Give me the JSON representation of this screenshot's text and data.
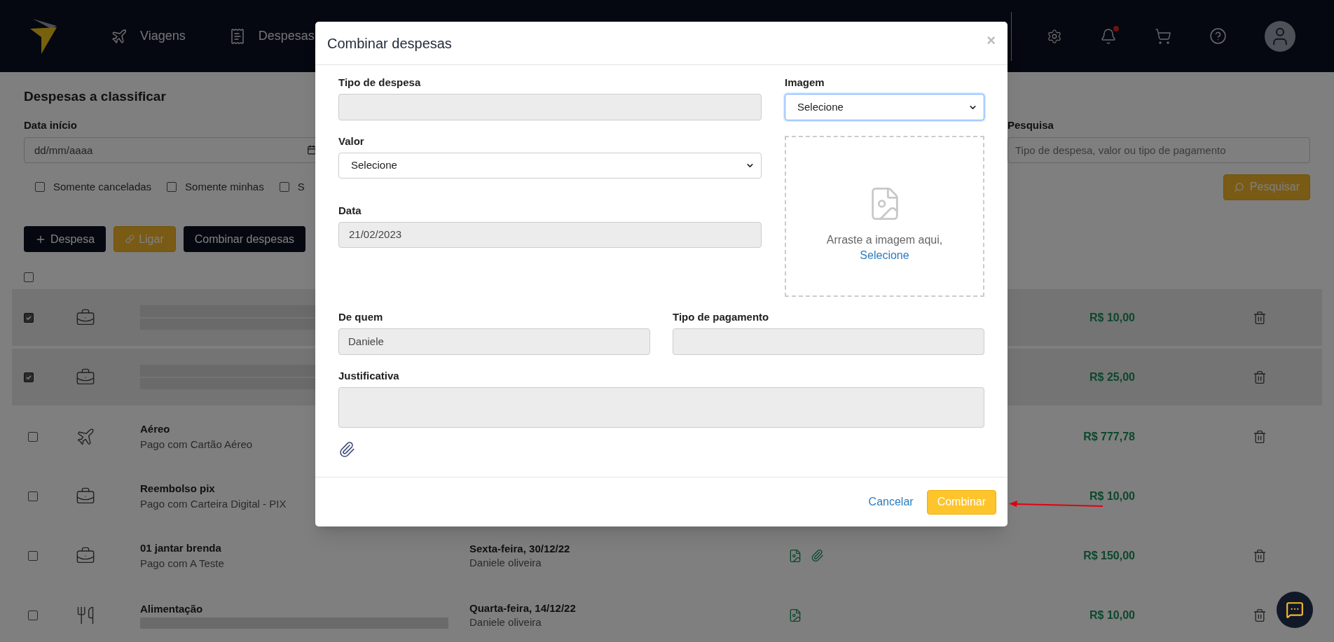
{
  "app_bar": {
    "nav": [
      {
        "label": "Viagens",
        "kind": "trips"
      },
      {
        "label": "Despesas",
        "kind": "expenses"
      }
    ],
    "has_notifications": true
  },
  "page": {
    "title": "Despesas a classificar",
    "start_date": {
      "label": "Data início",
      "placeholder": "dd/mm/aaaa"
    },
    "search": {
      "label": "Pesquisa",
      "placeholder": "Tipo de despesa, valor ou tipo de pagamento"
    },
    "checkboxes": [
      {
        "label": "Somente canceladas",
        "checked": false
      },
      {
        "label": "Somente minhas",
        "checked": false
      },
      {
        "label": "S",
        "checked": false
      }
    ],
    "search_button": "Pesquisar",
    "actions": [
      {
        "label": "Despesa",
        "kind": "add"
      },
      {
        "label": "Ligar",
        "kind": "link"
      },
      {
        "label": "Combinar despesas",
        "kind": "plain"
      }
    ],
    "select_all": {
      "checked": false
    },
    "rows": [
      {
        "selected": true,
        "checked": true,
        "kind": "travel",
        "amount": "R$ 10,00",
        "deletable": true
      },
      {
        "selected": true,
        "checked": true,
        "kind": "travel",
        "amount": "R$ 25,00",
        "deletable": true
      },
      {
        "selected": false,
        "checked": false,
        "kind": "flight",
        "title": "Aéreo",
        "subtitle": "Pago com Cartão Aéreo",
        "amount": "R$ 777,78",
        "deletable": true
      },
      {
        "selected": false,
        "checked": false,
        "kind": "travel",
        "title": "Reembolso pix",
        "subtitle": "Pago com Carteira Digital - PIX",
        "amount": "R$ 10,00",
        "deletable": false
      },
      {
        "selected": false,
        "checked": false,
        "kind": "travel",
        "title": "01 jantar brenda",
        "subtitle": "Pago com A Teste",
        "date": "Sexta-feira, 30/12/22",
        "person": "Daniele oliveira",
        "has_image": true,
        "has_attachment": true,
        "amount": "R$ 150,00",
        "deletable": true
      },
      {
        "selected": false,
        "checked": false,
        "kind": "meal",
        "title": "Alimentação",
        "date": "Quarta-feira, 14/12/22",
        "person": "Daniele oliveira",
        "has_image": true,
        "has_attachment": false,
        "amount": "R$ 10,00",
        "deletable": true
      }
    ]
  },
  "modal": {
    "title": "Combinar despesas",
    "close": "×",
    "expense_type": {
      "label": "Tipo de despesa"
    },
    "value": {
      "label": "Valor",
      "value": "Selecione"
    },
    "date": {
      "label": "Data",
      "value": "21/02/2023"
    },
    "image": {
      "label": "Imagem",
      "value": "Selecione"
    },
    "dropzone": {
      "text": "Arraste a imagem aqui,",
      "link": "Selecione"
    },
    "from": {
      "label": "De quem",
      "value": "Daniele"
    },
    "payment_type": {
      "label": "Tipo de pagamento"
    },
    "justification": {
      "label": "Justificativa"
    },
    "cancel": "Cancelar",
    "confirm": "Combinar"
  }
}
